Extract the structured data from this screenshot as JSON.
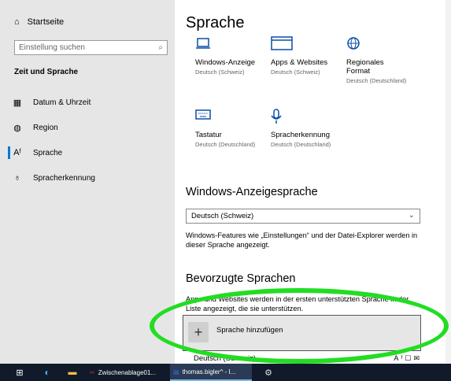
{
  "sidebar": {
    "home_label": "Startseite",
    "search_placeholder": "Einstellung suchen",
    "section_title": "Zeit und Sprache",
    "items": [
      {
        "label": "Datum & Uhrzeit",
        "icon": "calendar-clock-icon"
      },
      {
        "label": "Region",
        "icon": "globe-icon"
      },
      {
        "label": "Sprache",
        "icon": "language-icon",
        "selected": true
      },
      {
        "label": "Spracherkennung",
        "icon": "microphone-icon"
      }
    ]
  },
  "main": {
    "title": "Sprache",
    "tiles": [
      {
        "title": "Windows-Anzeige",
        "sub": "Deutsch (Schweiz)",
        "icon": "laptop-icon"
      },
      {
        "title": "Apps & Websites",
        "sub": "Deutsch (Schweiz)",
        "icon": "window-icon"
      },
      {
        "title": "Regionales Format",
        "sub": "Deutsch (Deutschland)",
        "icon": "globe-icon"
      },
      {
        "title": "Tastatur",
        "sub": "Deutsch (Deutschland)",
        "icon": "keyboard-icon"
      },
      {
        "title": "Spracherkennung",
        "sub": "Deutsch (Deutschland)",
        "icon": "microphone-icon"
      }
    ],
    "display_language": {
      "heading": "Windows-Anzeigesprache",
      "selected": "Deutsch (Schweiz)",
      "description": "Windows-Features wie „Einstellungen“ und der Datei-Explorer werden in dieser Sprache angezeigt."
    },
    "preferred": {
      "heading": "Bevorzugte Sprachen",
      "description": "Apps und Websites werden in der ersten unterstützten Sprache in der Liste angezeigt, die sie unterstützen.",
      "add_label": "Sprache hinzufügen",
      "first_language": "Deutsch (Schweiz)"
    }
  },
  "taskbar": {
    "items": [
      {
        "label": "Zwischenablage01...",
        "icon": "snip-icon"
      },
      {
        "label": "thomas.bigler^ - I...",
        "icon": "document-icon"
      }
    ]
  },
  "colors": {
    "accent": "#0078d7",
    "highlight": "#22dd22",
    "taskbar": "#101a2a"
  }
}
